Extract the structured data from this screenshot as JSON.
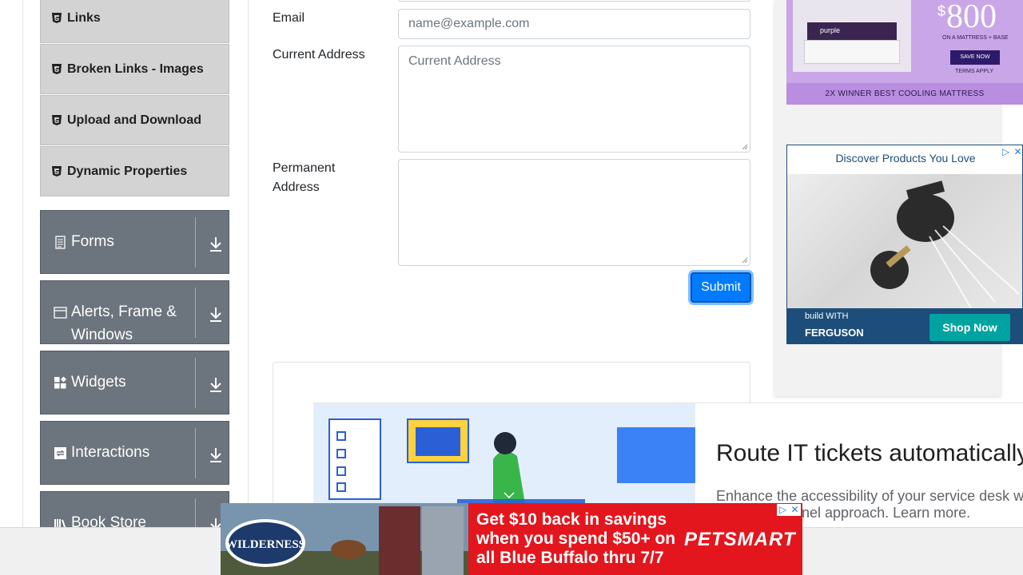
{
  "sidebar": {
    "sub_items": [
      {
        "label": "Links"
      },
      {
        "label": "Broken Links - Images"
      },
      {
        "label": "Upload and Download"
      },
      {
        "label": "Dynamic Properties"
      }
    ],
    "groups": [
      {
        "label": "Forms",
        "icon": "document-icon"
      },
      {
        "label": "Alerts, Frame & Windows",
        "icon": "window-icon"
      },
      {
        "label": "Widgets",
        "icon": "widgets-icon"
      },
      {
        "label": "Interactions",
        "icon": "interactions-icon"
      },
      {
        "label": "Book Store Application",
        "icon": "books-icon"
      }
    ]
  },
  "form": {
    "email_label": "Email",
    "email_placeholder": "name@example.com",
    "current_address_label": "Current Address",
    "current_address_placeholder": "Current Address",
    "permanent_address_label": "Permanent Address",
    "submit_label": "Submit"
  },
  "ads": {
    "purple": {
      "currency": "$",
      "amount": "800",
      "line1": "ON A MATTRESS + BASE",
      "save_now": "SAVE NOW",
      "terms": "TERMS APPLY",
      "brand": "purple",
      "banner": "2X WINNER BEST COOLING MATTRESS"
    },
    "ferguson": {
      "headline": "Discover Products You Love",
      "brand_small": "build WITH",
      "brand": "FERGUSON",
      "cta": "Shop Now"
    },
    "service_desk": {
      "headline": "Route IT tickets automatically",
      "sub_line1": "Enhance the accessibility of your service desk w",
      "sub_line2": "nnel approach. Learn more."
    },
    "petsmart": {
      "promo": "Get $10 back in savings when you spend $50+ on all Blue Buffalo thru 7/7",
      "brand": "PETSMART",
      "product": "WILDERNESS"
    }
  },
  "colors": {
    "submit_blue": "#007bff",
    "group_gray": "#6c757d",
    "subitem_gray": "#d3d3d3",
    "petsmart_red": "#e3161e",
    "ferguson_navy": "#1d4d7a"
  }
}
